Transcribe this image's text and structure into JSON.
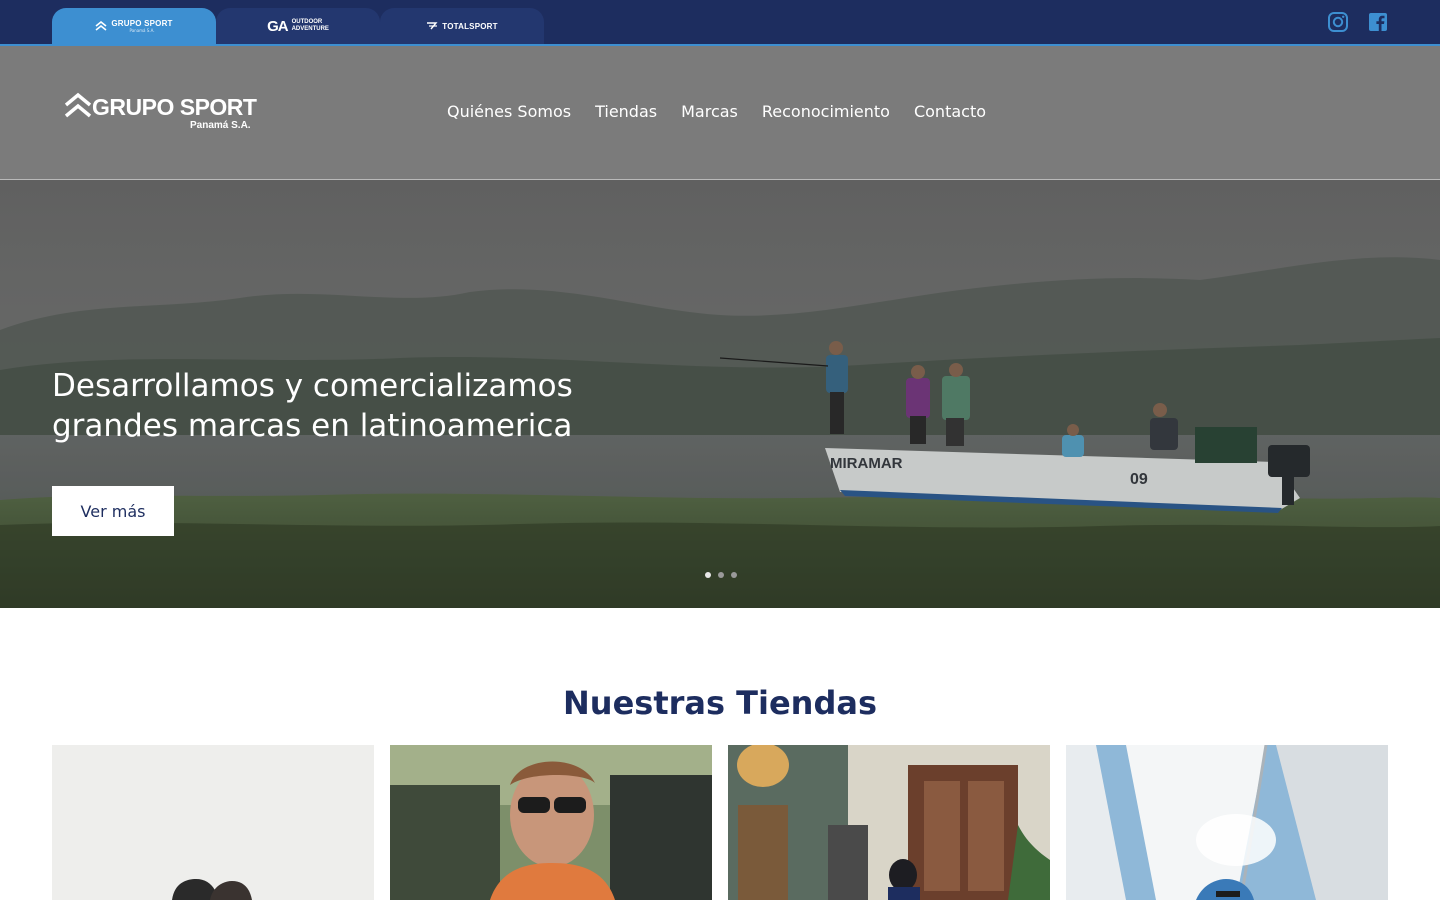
{
  "topbar": {
    "tabs": [
      {
        "label": "GRUPO SPORT",
        "sub": "Panamá S.A.",
        "icon": "grupo-sport-chevron-icon"
      },
      {
        "mark": "GA",
        "line1": "OUTDOOR",
        "line2": "ADVENTURE",
        "icon": "outdoor-adventure-logo"
      },
      {
        "label": "TOTALSPORT",
        "icon": "totalsport-icon"
      }
    ],
    "social": {
      "instagram": "instagram-icon",
      "facebook": "facebook-icon"
    }
  },
  "header": {
    "logo": {
      "name": "GRUPO SPORT",
      "tagline": "Panamá S.A."
    },
    "nav": [
      "Quiénes Somos",
      "Tiendas",
      "Marcas",
      "Reconocimiento",
      "Contacto"
    ]
  },
  "hero": {
    "title_line1": "Desarrollamos y comercializamos",
    "title_line2": "grandes marcas en latinoamerica",
    "button": "Ver más",
    "boat_name": "MIRAMAR",
    "boat_number": "09",
    "slides": 3,
    "active_slide": 1
  },
  "stores": {
    "title": "Nuestras Tiendas"
  },
  "colors": {
    "navy": "#1d2d5f",
    "accent_blue": "#3d8fd1",
    "header_gray": "#7b7b7b"
  }
}
